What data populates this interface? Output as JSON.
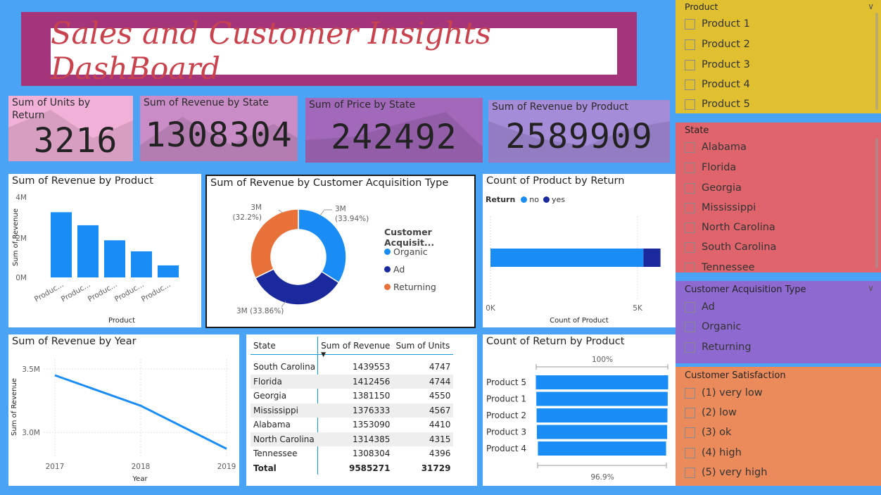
{
  "title": "Sales and Customer Insights DashBoard",
  "colors": {
    "background": "#4aa3f5",
    "title_frame": "#a5357b",
    "title_text": "#c9434f",
    "bar": "#1a8cf5",
    "organic": "#1a8cf5",
    "ad": "#1a2a9c",
    "returning": "#e8713a",
    "slicer_product": "#e0c030",
    "slicer_state": "#e0646c",
    "slicer_acquisition": "#8e6ad0",
    "slicer_satisfaction": "#eb8a5a"
  },
  "kpis": [
    {
      "title": "Sum of Units by Return",
      "value": "3216",
      "bg": "#f0b0d8"
    },
    {
      "title": "Sum of Revenue by State",
      "value": "1308304",
      "bg": "#c98cc6"
    },
    {
      "title": "Sum of Price by State",
      "value": "242492",
      "bg": "#a269ba"
    },
    {
      "title": "Sum of Revenue by Product",
      "value": "2589909",
      "bg": "#a48cd8"
    }
  ],
  "revenue_by_product": {
    "title": "Sum of Revenue by Product",
    "xlabel": "Product",
    "ylabel": "Sum of Revenue",
    "yticks": [
      "4M",
      "2M",
      "0M"
    ]
  },
  "acquisition_donut": {
    "title": "Sum of Revenue by Customer Acquisition Type",
    "legend_title": "Customer Acquisit...",
    "labels": {
      "organic_value": "3M",
      "organic_pct": "(33.94%)",
      "returning_value": "3M",
      "returning_pct": "(32.2%)",
      "ad": "3M (33.86%)"
    }
  },
  "count_by_return": {
    "title": "Count of Product by Return",
    "legend_title": "Return",
    "legend_no": "no",
    "legend_yes": "yes",
    "xticks": [
      "0K",
      "5K"
    ],
    "xlabel": "Count of Product"
  },
  "revenue_by_year": {
    "title": "Sum of Revenue by Year",
    "xlabel": "Year",
    "ylabel": "Sum of Revenue",
    "yticks": [
      "3.5M",
      "3.0M"
    ],
    "xticks": [
      "2017",
      "2018",
      "2019"
    ]
  },
  "table": {
    "headers": [
      "State",
      "Sum of Revenue",
      "Sum of Units"
    ],
    "rows": [
      [
        "South Carolina",
        "1439553",
        "4747"
      ],
      [
        "Florida",
        "1412456",
        "4744"
      ],
      [
        "Georgia",
        "1381150",
        "4550"
      ],
      [
        "Mississippi",
        "1376333",
        "4567"
      ],
      [
        "Alabama",
        "1353090",
        "4410"
      ],
      [
        "North Carolina",
        "1314385",
        "4315"
      ],
      [
        "Tennessee",
        "1308304",
        "4396"
      ]
    ],
    "total": [
      "Total",
      "9585271",
      "31729"
    ]
  },
  "return_by_product": {
    "title": "Count of Return by Product",
    "top_label": "100%",
    "bottom_label": "96.9%"
  },
  "slicers": {
    "product": {
      "title": "Product",
      "items": [
        "Product 1",
        "Product 2",
        "Product 3",
        "Product 4",
        "Product 5"
      ]
    },
    "state": {
      "title": "State",
      "items": [
        "Alabama",
        "Florida",
        "Georgia",
        "Mississippi",
        "North Carolina",
        "South Carolina",
        "Tennessee"
      ]
    },
    "acquisition": {
      "title": "Customer Acquisition Type",
      "items": [
        "Ad",
        "Organic",
        "Returning"
      ]
    },
    "satisfaction": {
      "title": "Customer Satisfaction",
      "items": [
        "(1) very low",
        "(2) low",
        "(3) ok",
        "(4) high",
        "(5) very high"
      ]
    }
  },
  "chart_data": [
    {
      "type": "bar",
      "title": "Sum of Revenue by Product",
      "xlabel": "Product",
      "ylabel": "Sum of Revenue",
      "categories": [
        "Produc...",
        "Produc...",
        "Produc...",
        "Produc...",
        "Produc..."
      ],
      "values": [
        3250000,
        2600000,
        1850000,
        1300000,
        600000
      ],
      "ylim": [
        0,
        4000000
      ],
      "yticks": [
        0,
        2000000,
        4000000
      ]
    },
    {
      "type": "pie",
      "title": "Sum of Revenue by Customer Acquisition Type",
      "legend_title": "Customer Acquisit...",
      "categories": [
        "Organic",
        "Ad",
        "Returning"
      ],
      "values": [
        33.94,
        33.86,
        32.2
      ],
      "legend": "right"
    },
    {
      "type": "bar",
      "title": "Count of Product by Return",
      "legend_title": "Return",
      "orientation": "horizontal",
      "stacked": true,
      "series": [
        {
          "name": "no",
          "values": [
            5200
          ]
        },
        {
          "name": "yes",
          "values": [
            580
          ]
        }
      ],
      "xlabel": "Count of Product",
      "xlim": [
        0,
        6000
      ],
      "xticks": [
        0,
        5000
      ],
      "legend": "top-left"
    },
    {
      "type": "line",
      "title": "Sum of Revenue by Year",
      "xlabel": "Year",
      "ylabel": "Sum of Revenue",
      "x": [
        2017,
        2018,
        2019
      ],
      "values": [
        3450000,
        3210000,
        2870000
      ],
      "ylim": [
        2800000,
        3600000
      ],
      "yticks": [
        3000000,
        3500000
      ]
    },
    {
      "type": "bar",
      "title": "Count of Return by Product",
      "orientation": "horizontal",
      "categories": [
        "Product 5",
        "Product 1",
        "Product 2",
        "Product 3",
        "Product 4"
      ],
      "values": [
        100,
        99.3,
        98.9,
        98.5,
        96.9
      ],
      "annotations": [
        "100%",
        "96.9%"
      ]
    }
  ]
}
